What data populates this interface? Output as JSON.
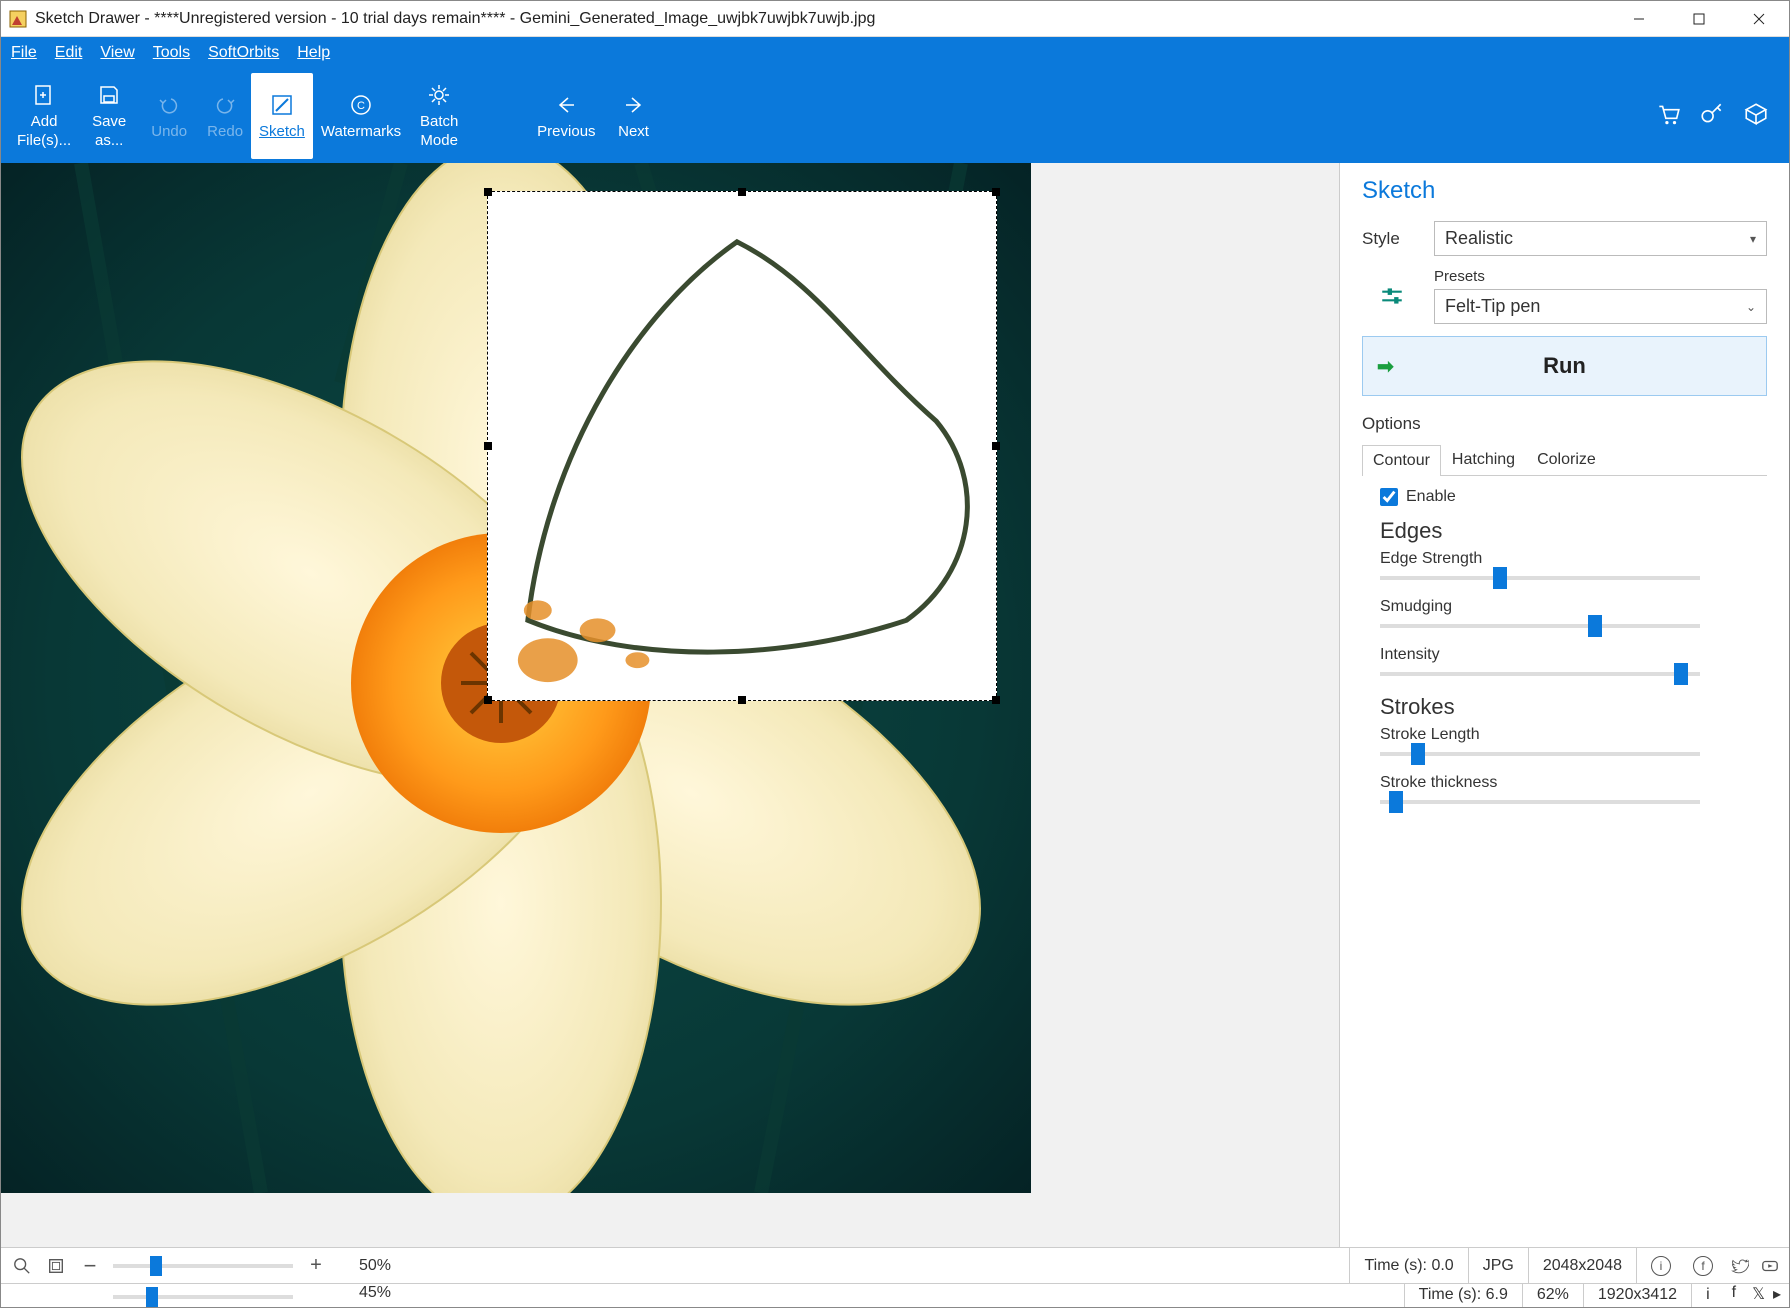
{
  "window": {
    "title": "Sketch Drawer - ****Unregistered version - 10 trial days remain**** - Gemini_Generated_Image_uwjbk7uwjbk7uwjb.jpg"
  },
  "menu": {
    "file": "File",
    "edit": "Edit",
    "view": "View",
    "tools": "Tools",
    "softorbits": "SoftOrbits",
    "help": "Help"
  },
  "ribbon": {
    "add": "Add\nFile(s)...",
    "save": "Save\nas...",
    "undo": "Undo",
    "redo": "Redo",
    "sketch": "Sketch",
    "watermarks": "Watermarks",
    "batch": "Batch\nMode",
    "previous": "Previous",
    "next": "Next"
  },
  "panel": {
    "title": "Sketch",
    "style_label": "Style",
    "style_value": "Realistic",
    "presets_label": "Presets",
    "preset_value": "Felt-Tip pen",
    "run": "Run",
    "options": "Options",
    "tabs": {
      "contour": "Contour",
      "hatching": "Hatching",
      "colorize": "Colorize"
    },
    "enable": "Enable",
    "edges_header": "Edges",
    "sliders": {
      "edge_strength": {
        "label": "Edge Strength",
        "pct": 37
      },
      "smudging": {
        "label": "Smudging",
        "pct": 68
      },
      "intensity": {
        "label": "Intensity",
        "pct": 96
      }
    },
    "strokes_header": "Strokes",
    "stroke_sliders": {
      "length": {
        "label": "Stroke Length",
        "pct": 10
      },
      "thickness": {
        "label": "Stroke thickness",
        "pct": 3
      }
    }
  },
  "status": {
    "zoom_text": "50%",
    "zoom_pct": 22,
    "time": "Time (s): 0.0",
    "format": "JPG",
    "dims": "2048x2048"
  },
  "clip_status": {
    "zoom_text": "45%",
    "zoom_pct": 20,
    "time": "Time (s): 6.9",
    "pct": "62%",
    "dims": "1920x3412"
  }
}
